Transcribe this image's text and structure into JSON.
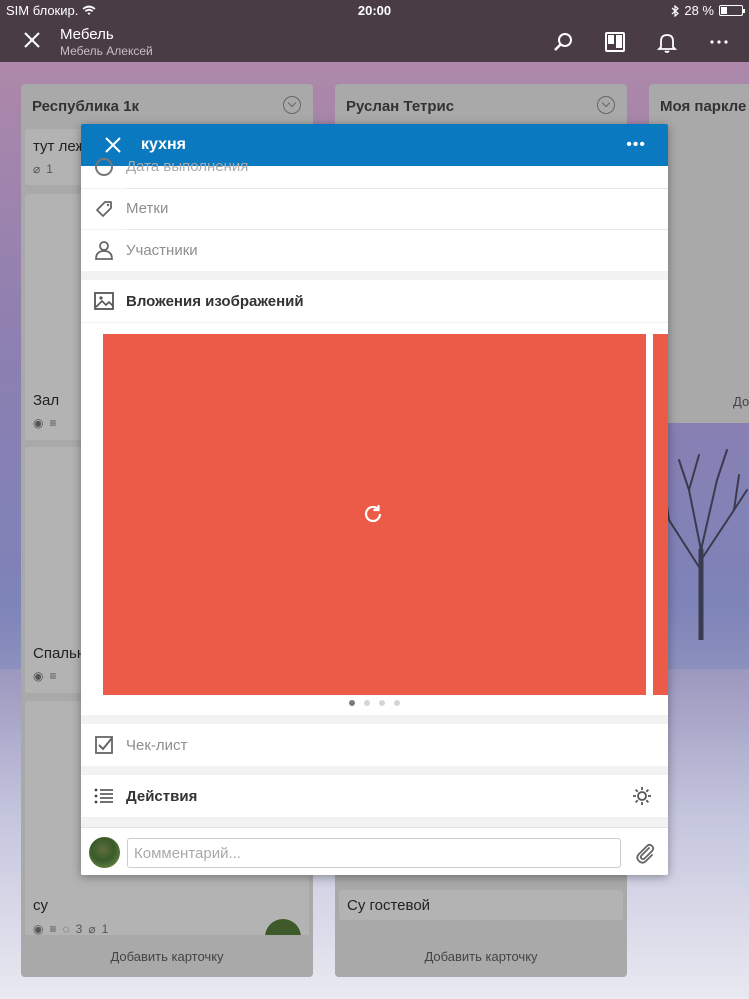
{
  "status_bar": {
    "carrier": "SIM блокир.",
    "time": "20:00",
    "battery_text": "28 %",
    "battery_level": 0.28
  },
  "app_header": {
    "title": "Мебель",
    "subtitle": "Мебель Алексей"
  },
  "lists": [
    {
      "title": "Республика 1к",
      "cards": [
        {
          "label": "тут леж",
          "attachments": "1"
        },
        {
          "label": "Зал"
        },
        {
          "label": "Спальн"
        },
        {
          "label": "су",
          "comments": "3",
          "attachments": "1"
        }
      ],
      "add_card": "Добавить карточку"
    },
    {
      "title": "Руслан Тетрис",
      "cards": [
        {
          "label": "Су гостевой"
        }
      ],
      "add_card": "Добавить карточку"
    },
    {
      "title": "Моя паркле",
      "add_card_partial": "До"
    }
  ],
  "modal": {
    "title": "кухня",
    "rows": {
      "due_date": "Дата выполнения",
      "labels": "Метки",
      "members": "Участники",
      "image_attachments": "Вложения изображений",
      "checklist": "Чек-лист",
      "activity": "Действия"
    },
    "carousel": {
      "slide_count": 4,
      "active_index": 0,
      "image_color": "#ec5b47"
    },
    "comment": {
      "placeholder": "Комментарий..."
    }
  },
  "colors": {
    "header_dark": "#4a3c44",
    "modal_blue": "#0b79c0",
    "placeholder_red": "#ec5b47"
  }
}
